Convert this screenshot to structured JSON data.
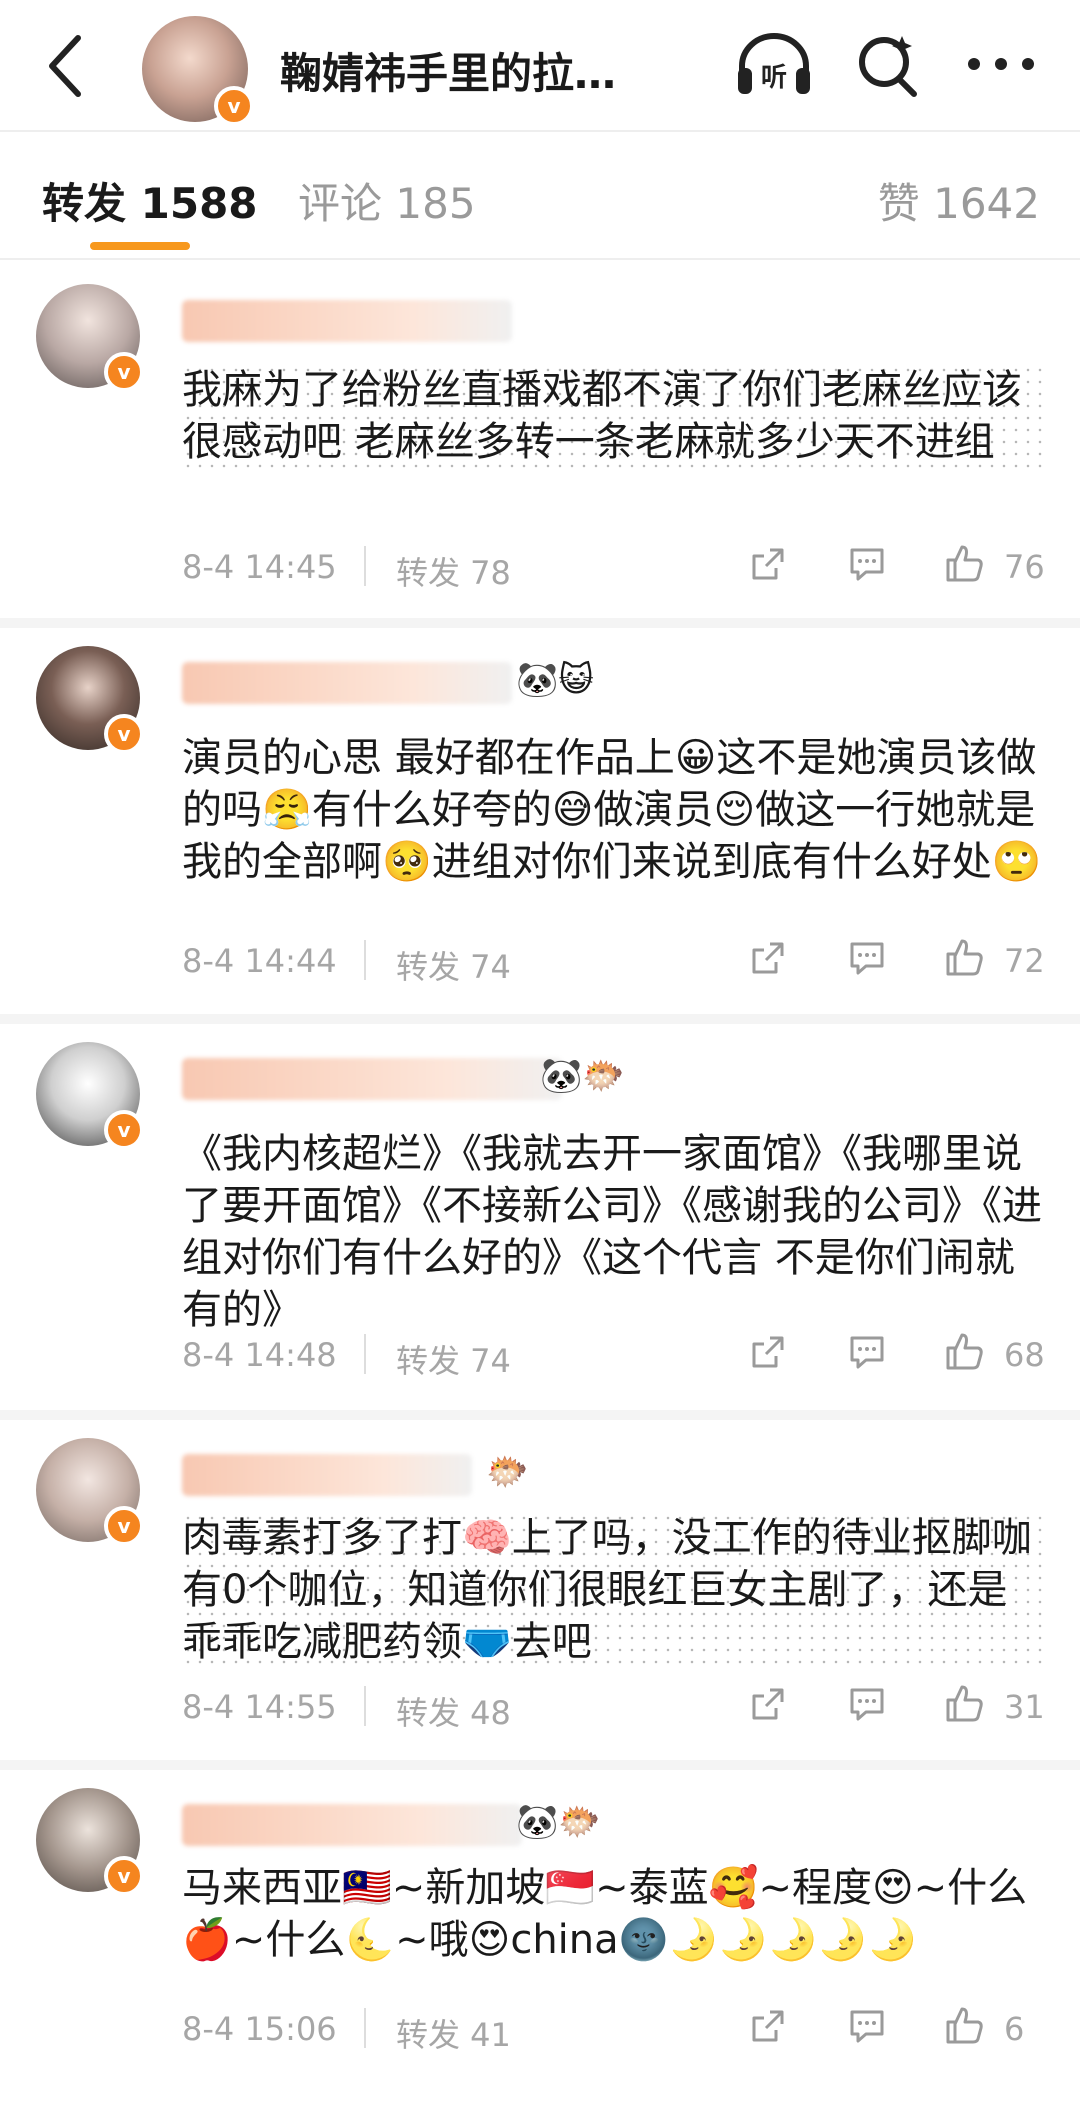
{
  "header": {
    "title": "鞠婧祎手里的拉…",
    "icons": [
      "back-arrow-icon",
      "listen-icon",
      "search-icon",
      "more-icon"
    ],
    "listen_label": "听",
    "verified_badge": "v"
  },
  "tabs": [
    {
      "label": "转发",
      "count": "1588",
      "active": true
    },
    {
      "label": "评论",
      "count": "185",
      "active": false
    },
    {
      "label": "赞",
      "count": "1642",
      "active": false
    }
  ],
  "colors": {
    "accent": "#f7981d",
    "verified": "#f5851f",
    "meta_text": "#a6a6a6"
  },
  "posts": [
    {
      "content": "我麻为了给粉丝直播戏都不演了你们老麻丝应该很感动吧 老麻丝多转一条老麻就多少天不进组",
      "time": "8-4 14:45",
      "repost_label": "转发 78",
      "likes": "76",
      "name_emoji": ""
    },
    {
      "content": "演员的心思 最好都在作品上😀这不是她演员该做的吗😤有什么好夸的😅做演员😌做这一行她就是我的全部啊🥺进组对你们来说到底有什么好处🙄",
      "time": "8-4 14:44",
      "repost_label": "转发 74",
      "likes": "72",
      "name_emoji": "🐼😺"
    },
    {
      "content": "《我内核超烂》《我就去开一家面馆》《我哪里说了要开面馆》《不接新公司》《感谢我的公司》《进组对你们有什么好的》《这个代言 不是你们闹就有的》",
      "time": "8-4 14:48",
      "repost_label": "转发 74",
      "likes": "68",
      "name_emoji": "🐼🐡"
    },
    {
      "content": "肉毒素打多了打🧠上了吗，没工作的待业抠脚咖有0个咖位，知道你们很眼红巨女主剧了，还是乖乖吃减肥药领🩲去吧",
      "time": "8-4 14:55",
      "repost_label": "转发 48",
      "likes": "31",
      "name_emoji": "🐡"
    },
    {
      "content": "马来西亚🇲🇾~新加坡🇸🇬~泰蓝🥰~程度😍~什么🍎~什么🌜~哦😍china🌚🌛🌛🌛🌛🌛",
      "time": "8-4 15:06",
      "repost_label": "转发 41",
      "likes": "6",
      "name_emoji": "🐼🐡"
    }
  ]
}
